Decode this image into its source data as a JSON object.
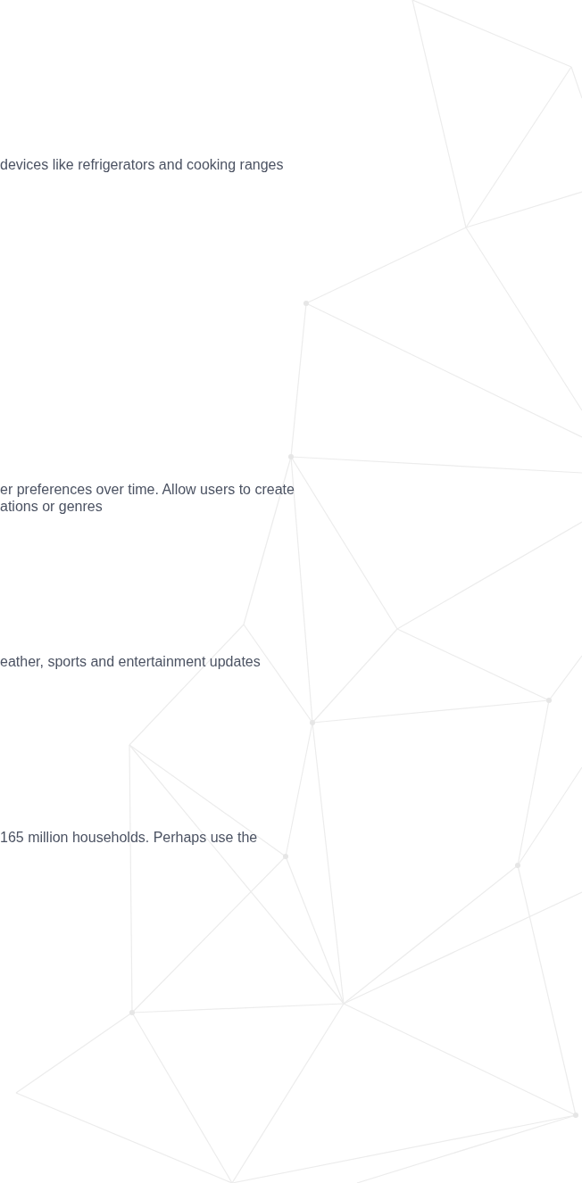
{
  "paragraphs": [
    {
      "lines": [
        "devices like refrigerators and cooking ranges"
      ]
    },
    {
      "lines": [
        "er preferences over time. Allow users to create",
        "ations or genres"
      ]
    },
    {
      "lines": [
        "eather, sports and entertainment updates"
      ]
    },
    {
      "lines": [
        "165 million households. Perhaps use the"
      ]
    }
  ]
}
